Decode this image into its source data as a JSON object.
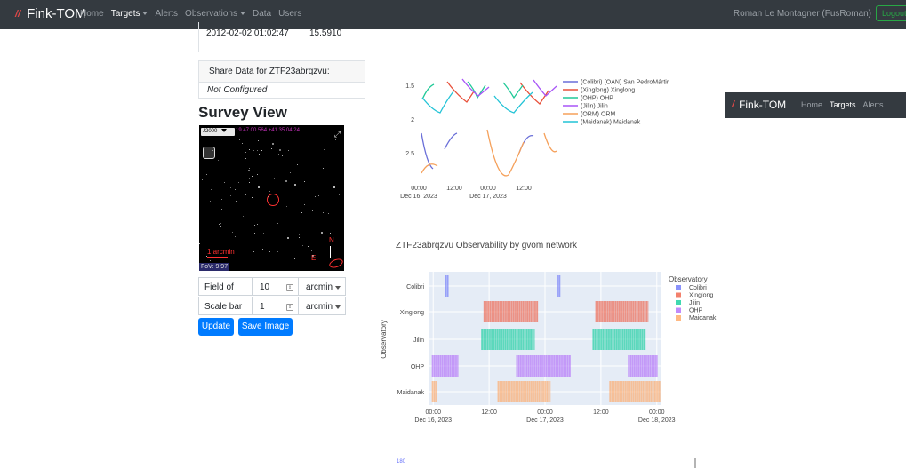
{
  "navbar": {
    "brand": "Fink-TOM",
    "links": [
      {
        "label": "Home",
        "active": false,
        "dropdown": false
      },
      {
        "label": "Targets",
        "active": true,
        "dropdown": true
      },
      {
        "label": "Alerts",
        "active": false,
        "dropdown": false
      },
      {
        "label": "Observations",
        "active": false,
        "dropdown": true
      },
      {
        "label": "Data",
        "active": false,
        "dropdown": false
      },
      {
        "label": "Users",
        "active": false,
        "dropdown": false
      }
    ],
    "user": "Roman Le Montagner (FusRoman)",
    "logout": "Logout",
    "background": "#343a40"
  },
  "photometry_row": {
    "date": "2012-02-02 01:02:47",
    "value": "15.5910"
  },
  "share": {
    "header": "Share Data for ZTF23abrqzvu:",
    "body": "Not Configured"
  },
  "survey": {
    "title": "Survey View",
    "frame": "J2000",
    "coords": "19 47 00.564 +41 35 04.24",
    "scale_label": "1 arcmin",
    "north": "N",
    "east": "E",
    "fov": "FoV: 9.97",
    "form": {
      "fov_label": "Field of view",
      "fov_value": "10",
      "fov_unit": "arcmin",
      "scale_label": "Scale bar",
      "scale_value": "1",
      "scale_unit": "arcmin"
    },
    "buttons": {
      "update": "Update",
      "save": "Save Image"
    }
  },
  "airmass_plot": {
    "y_ticks": [
      "1.5",
      "2",
      "2.5"
    ],
    "x_ticks": [
      {
        "label": "00:00",
        "sub": "Dec 16, 2023"
      },
      {
        "label": "12:00",
        "sub": ""
      },
      {
        "label": "00:00",
        "sub": "Dec 17, 2023"
      },
      {
        "label": "12:00",
        "sub": ""
      }
    ],
    "legend": [
      {
        "label": "(Colibri) (OAN) San PedroMártir",
        "color": "#6a6fd8"
      },
      {
        "label": "(Xinglong) Xinglong",
        "color": "#e8503a"
      },
      {
        "label": "(OHP) OHP",
        "color": "#20c997"
      },
      {
        "label": "(Jilin) Jilin",
        "color": "#a855f7"
      },
      {
        "label": "(ORM) ORM",
        "color": "#f5a05a"
      },
      {
        "label": "(Maidanak) Maidanak",
        "color": "#22c3d6"
      }
    ]
  },
  "chart_data": {
    "type": "bar",
    "title": "ZTF23abrqzvu Observability by gvom network",
    "ylabel": "Observatory",
    "categories": [
      "Colibri",
      "Xinglong",
      "Jilin",
      "OHP",
      "Maidanak"
    ],
    "x_ticks": [
      {
        "label": "00:00",
        "sub": "Dec 16, 2023",
        "t": 0
      },
      {
        "label": "12:00",
        "sub": "",
        "t": 12
      },
      {
        "label": "00:00",
        "sub": "Dec 17, 2023",
        "t": 24
      },
      {
        "label": "12:00",
        "sub": "",
        "t": 36
      },
      {
        "label": "00:00",
        "sub": "Dec 18, 2023",
        "t": 48
      }
    ],
    "xlim_hours_from_dec16": [
      -1,
      49
    ],
    "legend_title": "Observatory",
    "series": [
      {
        "name": "Colibri",
        "color": "#636efa",
        "intervals": [
          [
            2.5,
            3.3
          ],
          [
            26.5,
            27.3
          ]
        ]
      },
      {
        "name": "Xinglong",
        "color": "#ef553b",
        "intervals": [
          [
            10.8,
            22.5
          ],
          [
            34.8,
            46.2
          ]
        ]
      },
      {
        "name": "Jilin",
        "color": "#00cc96",
        "intervals": [
          [
            10.3,
            21.8
          ],
          [
            34.2,
            45.6
          ]
        ]
      },
      {
        "name": "OHP",
        "color": "#ab63fa",
        "intervals": [
          [
            -0.3,
            5.4
          ],
          [
            17.8,
            29.5
          ],
          [
            41.8,
            48.2
          ]
        ]
      },
      {
        "name": "Maidanak",
        "color": "#ffa15a",
        "intervals": [
          [
            -0.3,
            0.8
          ],
          [
            13.8,
            25.2
          ],
          [
            37.8,
            49.2
          ]
        ]
      }
    ]
  },
  "bottom_plot": {
    "tick": "180"
  },
  "embedded_nav": {
    "brand": "Fink-TOM",
    "links": [
      {
        "label": "Home",
        "active": false
      },
      {
        "label": "Targets",
        "active": true
      },
      {
        "label": "Alerts",
        "active": false
      }
    ]
  }
}
